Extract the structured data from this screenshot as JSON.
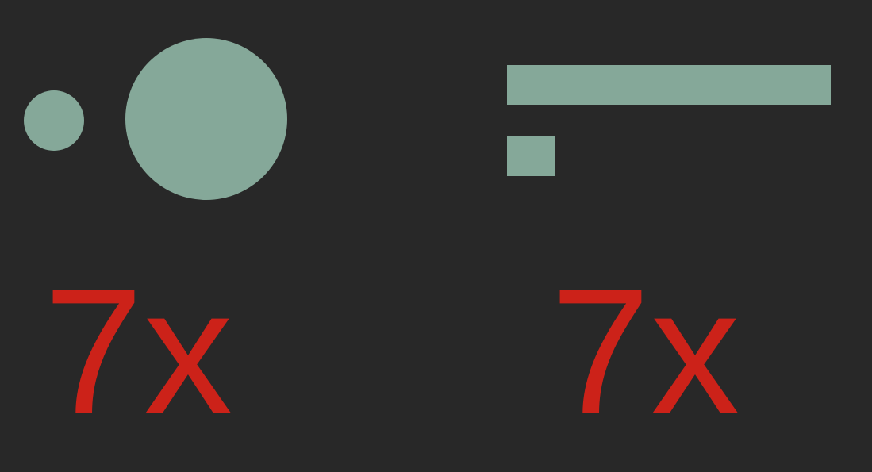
{
  "colors": {
    "background": "#282828",
    "shape_fill": "#85a899",
    "label_text": "#cc2219"
  },
  "panels": [
    {
      "shape_type": "circle",
      "ratio_label": "7x",
      "relative_area": {
        "small": 1,
        "large": 7
      }
    },
    {
      "shape_type": "bar",
      "ratio_label": "7x",
      "relative_length": {
        "short": 1,
        "long": 7
      }
    }
  ]
}
